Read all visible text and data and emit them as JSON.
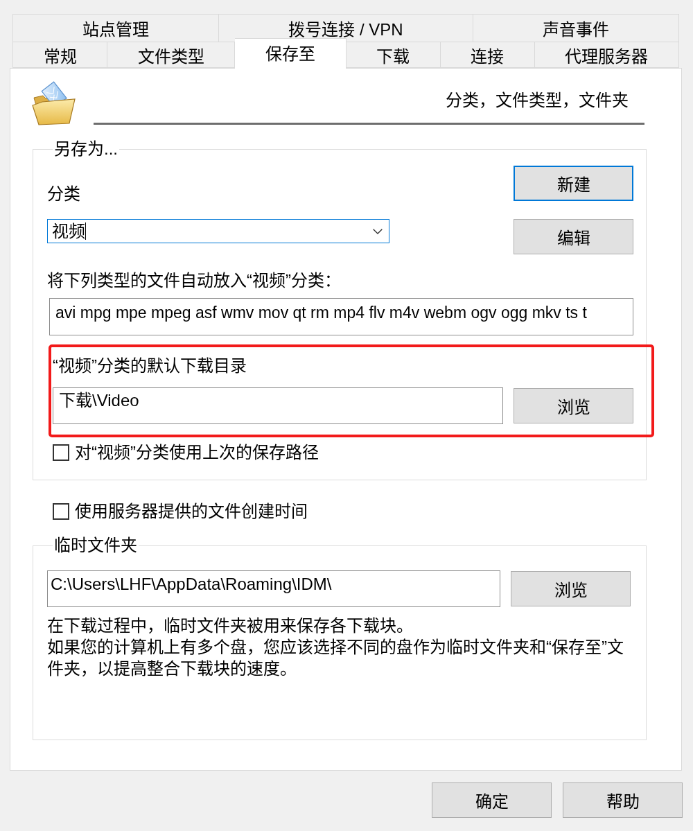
{
  "tab_rows": [
    [
      {
        "label": "站点管理",
        "selected": false
      },
      {
        "label": "拨号连接 / VPN",
        "selected": false
      },
      {
        "label": "声音事件",
        "selected": false
      }
    ],
    [
      {
        "label": "常规",
        "selected": false
      },
      {
        "label": "文件类型",
        "selected": false
      },
      {
        "label": "保存至",
        "selected": true
      },
      {
        "label": "下载",
        "selected": false
      },
      {
        "label": "连接",
        "selected": false
      },
      {
        "label": "代理服务器",
        "selected": false
      }
    ]
  ],
  "header": {
    "title": "分类，文件类型，文件夹"
  },
  "save_as": {
    "title": "另存为...",
    "category": {
      "label": "分类",
      "value": "视频",
      "focused": true
    },
    "buttons": [
      {
        "label": "新建",
        "focused": true
      },
      {
        "label": "编辑",
        "focused": false
      }
    ],
    "file_types": {
      "label": "将下列类型的文件自动放入“视频”分类：",
      "value": "avi mpg mpe mpeg asf wmv mov qt rm mp4 flv m4v webm ogv ogg mkv ts t"
    },
    "default_folder": {
      "label": "“视频”分类的默认下载目录",
      "value": "下载\\Video",
      "button": "浏览",
      "highlighted": true
    },
    "use_last_path": {
      "label": "对“视频”分类使用上次的保存路径",
      "checked": false
    }
  },
  "server_time": {
    "label": "使用服务器提供的文件创建时间",
    "checked": false
  },
  "temp_folder": {
    "title": "临时文件夹",
    "value": "C:\\Users\\LHF\\AppData\\Roaming\\IDM\\",
    "button": "浏览",
    "notes": [
      "在下载过程中，临时文件夹被用来保存各下载块。",
      "如果您的计算机上有多个盘，您应该选择不同的盘作为临时文件夹和“保存至”文件夹，以提高整合下载块的速度。"
    ]
  },
  "buttons": [
    {
      "label": "确定"
    },
    {
      "label": "帮助"
    }
  ]
}
